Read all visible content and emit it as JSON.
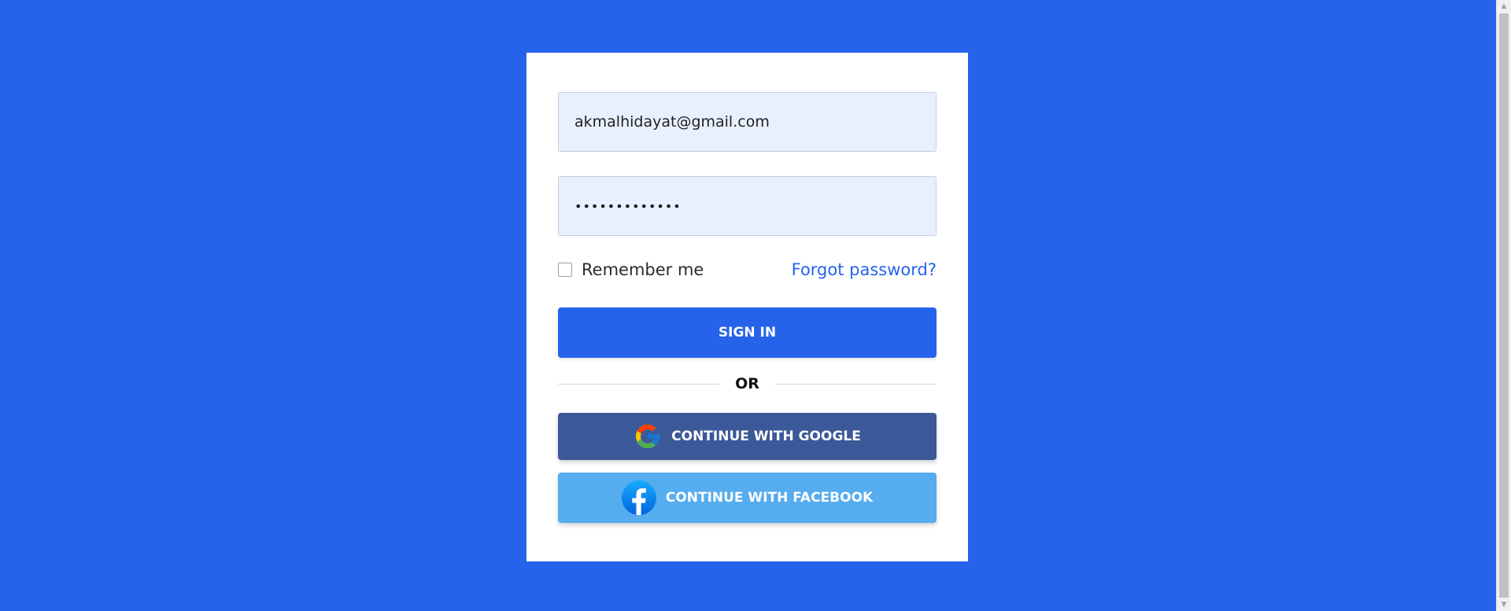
{
  "form": {
    "email_value": "akmalhidayat@gmail.com",
    "password_value": "•••••••••••••",
    "remember_label": "Remember me",
    "remember_checked": false,
    "forgot_label": "Forgot password?",
    "signin_label": "SIGN IN",
    "divider_label": "OR",
    "google_label": "CONTINUE WITH GOOGLE",
    "facebook_label": "CONTINUE WITH FACEBOOK"
  },
  "icons": {
    "google": "google-logo-icon",
    "facebook": "facebook-logo-icon"
  },
  "colors": {
    "background": "#2563eb",
    "primary": "#2563eb",
    "google_button": "#3b5998",
    "facebook_button": "#55acee",
    "input_background": "#e8f0fe"
  }
}
